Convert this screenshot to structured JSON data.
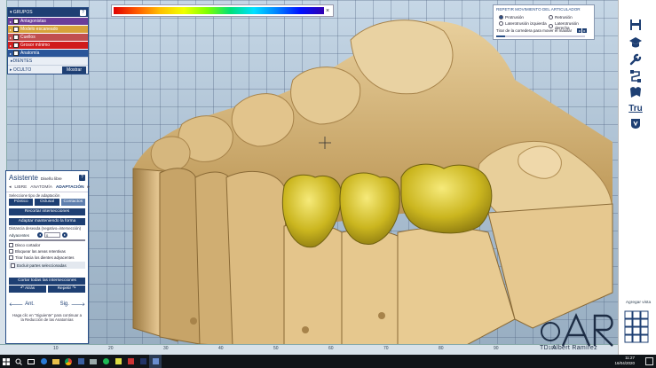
{
  "groups_panel": {
    "title": "GRUPOS",
    "help": "?",
    "layers": [
      {
        "label": "Antagonistas",
        "color": "#6a3d9a"
      },
      {
        "label": "Modelo escaneado",
        "color": "#d6a23a"
      },
      {
        "label": "Cuellos",
        "color": "#c14f4f"
      },
      {
        "label": "Grosor mínimo",
        "color": "#d01c1c"
      },
      {
        "label": "Anatomía",
        "color": "#2a5599"
      }
    ],
    "dientes_label": "DIENTES",
    "oculto_label": "OCULTO",
    "mostrar_button": "Mostrar"
  },
  "color_scale": {
    "close": "×"
  },
  "articulator": {
    "title": "REPETIR MOVIMIENTO DEL ARTICULADOR",
    "options": [
      "Protrusión",
      "Retrusión",
      "Laterotrusión izquierda",
      "Laterotrusión derecha"
    ],
    "selected": "Protrusión",
    "slider_label": "Tirar de la corredera para mover el maxilar",
    "slider_value": 0.1
  },
  "assistant": {
    "title": "Asistente",
    "mode": "Diseño libre",
    "help": "?",
    "tabs": [
      "LIBRE",
      "ANATOMÍA",
      "ADAPTACIÓN"
    ],
    "active_tab": "ADAPTACIÓN",
    "adapt_type_label": "Seleccione tipo de adaptación",
    "type_buttons": [
      "Póntico",
      "Oclusal",
      "Contactos"
    ],
    "cut_button": "Recortar intersecciones",
    "adapt_button": "Adaptar manteniendo la forma",
    "distance_label": "Distancia deseada (negativo=intersección)",
    "adjacent_label": "Adyacentes",
    "adjacent_value": "0",
    "checkboxes": [
      "Disco cortador",
      "Bloquear las areas retentivas",
      "Tirar hacia los dientes adyacentes"
    ],
    "exclude_label": "Excluir partes seleccionadas",
    "cut_all_button": "Cortar todas las intersecciones",
    "back_small": "Atrás",
    "redo_small": "Repetir",
    "prev": "Ant.",
    "next": "Sig.",
    "hint": "Haga clic en \"Siguiente\" para continuar a la Reducción de las Anatomías"
  },
  "sidebar": {
    "tru_label": "Tru",
    "add_view_label": "Agregar vista"
  },
  "ruler_ticks": [
    "10",
    "20",
    "30",
    "40",
    "50",
    "60",
    "70",
    "80",
    "90",
    "100"
  ],
  "watermark": {
    "name": "TD. Albert Ramírez"
  },
  "taskbar": {
    "time": "11:27",
    "date": "16/04/2020"
  },
  "colors": {
    "accent": "#1e3f73",
    "model": "#d9b77a",
    "crown": "#d4c32a"
  }
}
